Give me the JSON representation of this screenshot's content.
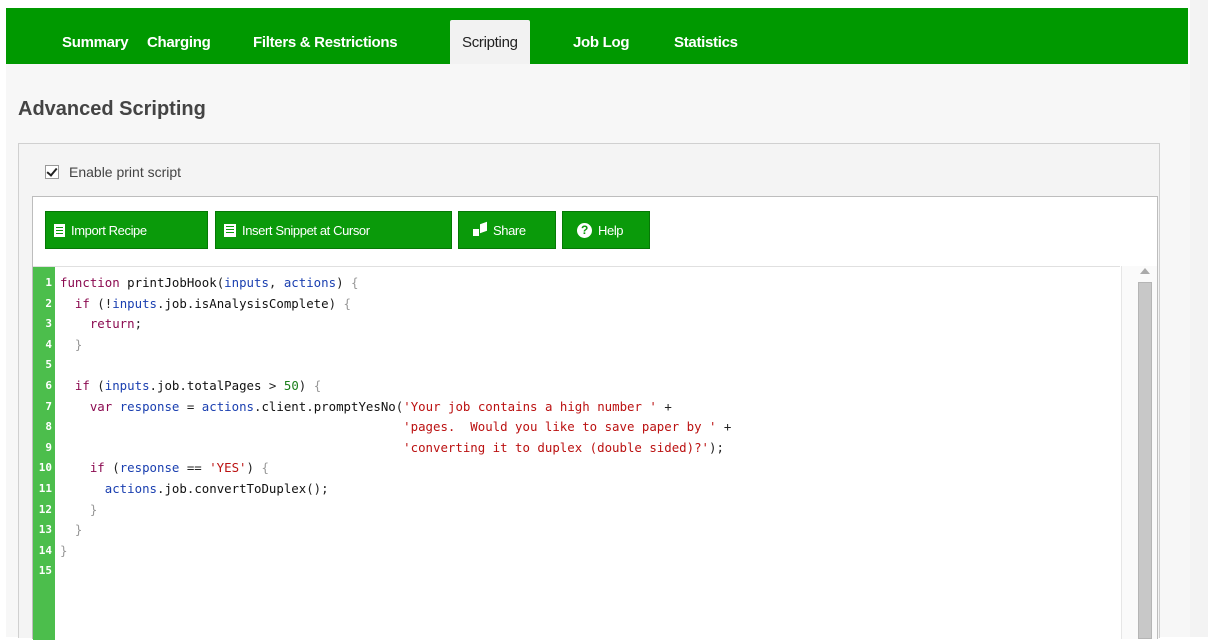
{
  "tabs": [
    {
      "label": "Summary",
      "active": false
    },
    {
      "label": "Charging",
      "active": false
    },
    {
      "label": "Filters & Restrictions",
      "active": false
    },
    {
      "label": "Scripting",
      "active": true
    },
    {
      "label": "Job Log",
      "active": false
    },
    {
      "label": "Statistics",
      "active": false
    }
  ],
  "page_title": "Advanced Scripting",
  "enable_script": {
    "label": "Enable print script",
    "checked": true
  },
  "toolbar": {
    "import_label": "Import Recipe",
    "snippet_label": "Insert Snippet at Cursor",
    "share_label": "Share",
    "help_label": "Help"
  },
  "code": {
    "line_numbers": [
      "1",
      "2",
      "3",
      "4",
      "5",
      "6",
      "7",
      "8",
      "9",
      "10",
      "11",
      "12",
      "13",
      "14",
      "15"
    ],
    "lines": [
      "function printJobHook(inputs, actions) {",
      "  if (!inputs.job.isAnalysisComplete) {",
      "    return;",
      "  }",
      "",
      "  if (inputs.job.totalPages > 50) {",
      "    var response = actions.client.promptYesNo('Your job contains a high number ' +",
      "                                              'pages.  Would you like to save paper by ' +",
      "                                              'converting it to duplex (double sided)?');",
      "    if (response == 'YES') {",
      "      actions.job.convertToDuplex();",
      "    }",
      "  }",
      "}",
      ""
    ]
  },
  "colors": {
    "brand_green": "#009900",
    "gutter_green": "#4cbe4c",
    "button_green": "#0a9a0a"
  },
  "icons": {
    "import": "document-icon",
    "snippet": "snippet-icon",
    "share": "share-icon",
    "help": "help-icon"
  }
}
